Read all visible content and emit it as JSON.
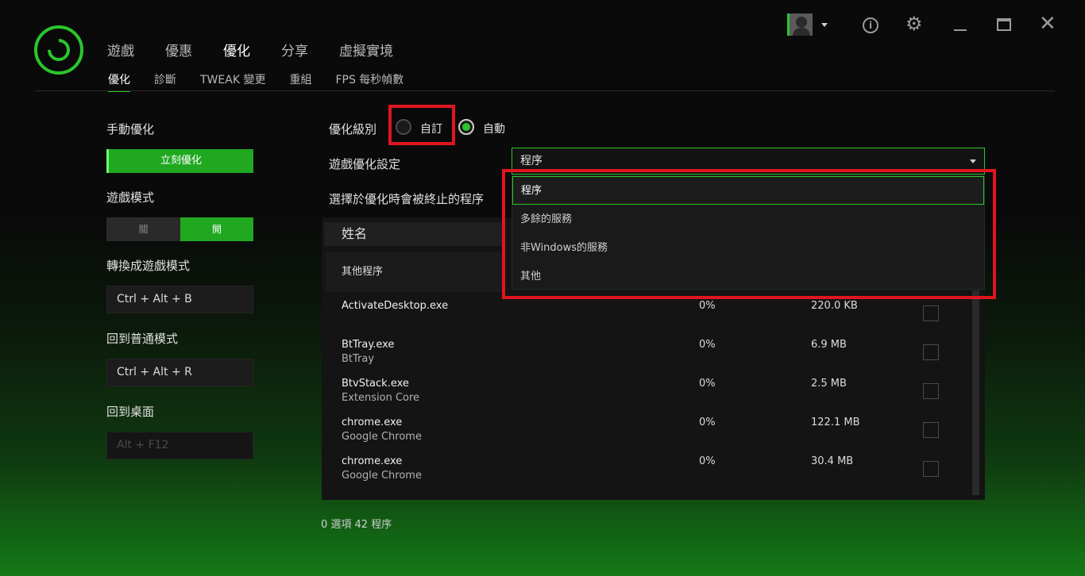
{
  "nav": {
    "tabs": [
      "遊戲",
      "優惠",
      "優化",
      "分享",
      "虛擬實境"
    ],
    "active_tab": "優化",
    "subtabs": [
      "優化",
      "診斷",
      "TWEAK 變更",
      "重組",
      "FPS 每秒幀數"
    ],
    "active_subtab": "優化"
  },
  "left": {
    "manual_label": "手動優化",
    "optimize_now": "立刻優化",
    "game_mode_label": "遊戲模式",
    "toggle_off": "關",
    "toggle_on": "開",
    "switch_label": "轉換成遊戲模式",
    "switch_keys": "Ctrl + Alt + B",
    "normal_label": "回到普通模式",
    "normal_keys": "Ctrl + Alt + R",
    "desktop_label": "回到桌面",
    "desktop_keys": "Alt + F12"
  },
  "right": {
    "level_label": "優化級別",
    "radio_custom": "自訂",
    "radio_auto": "自動",
    "selected_radio": "自動",
    "setting_label": "遊戲優化設定",
    "select_value": "程序",
    "terminate_label": "選擇於優化時會被終止的程序",
    "dropdown_options": [
      "程序",
      "多餘的服務",
      "非Windows的服務",
      "其他"
    ],
    "selected_option": "程序"
  },
  "table": {
    "header_name": "姓名",
    "group_label": "其他程序",
    "rows": [
      {
        "name": "ActivateDesktop.exe",
        "desc": "",
        "cpu": "0%",
        "mem": "220.0 KB"
      },
      {
        "name": "BtTray.exe",
        "desc": "BtTray",
        "cpu": "0%",
        "mem": "6.9 MB"
      },
      {
        "name": "BtvStack.exe",
        "desc": "Extension Core",
        "cpu": "0%",
        "mem": "2.5 MB"
      },
      {
        "name": "chrome.exe",
        "desc": "Google Chrome",
        "cpu": "0%",
        "mem": "122.1 MB"
      },
      {
        "name": "chrome.exe",
        "desc": "Google Chrome",
        "cpu": "0%",
        "mem": "30.4 MB"
      }
    ]
  },
  "footer": "0 選項 42 程序",
  "colors": {
    "accent": "#2ac62c",
    "highlight": "#e0151f",
    "background": "#0a0a0a"
  }
}
